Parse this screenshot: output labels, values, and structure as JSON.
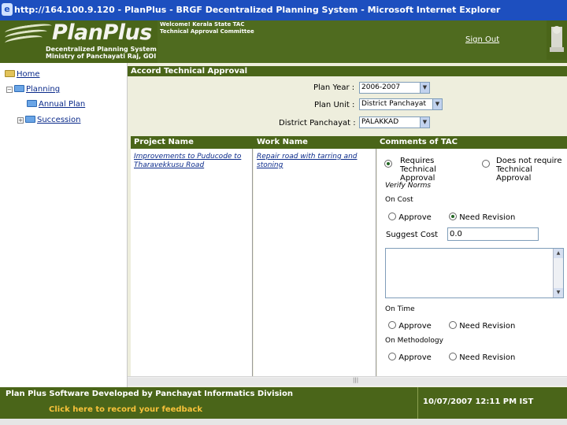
{
  "window": {
    "title": "http://164.100.9.120 - PlanPlus - BRGF Decentralized Planning System - Microsoft Internet Explorer"
  },
  "header": {
    "logo": "PlanPlus",
    "logo_sub1": "Decentralized Planning System",
    "logo_sub2": "Ministry of Panchayati Raj, GOI",
    "welcome": "Welcome! Kerala State TAC Technical Approval Committee",
    "signout": "Sign Out",
    "emblem_icon": "state-emblem-icon"
  },
  "nav": {
    "home": "Home",
    "planning": "Planning",
    "annual_plan": "Annual Plan",
    "succession": "Succession"
  },
  "panel": {
    "title": "Accord Technical Approval",
    "plan_year_label": "Plan Year :",
    "plan_year_value": "2006-2007",
    "plan_unit_label": "Plan Unit :",
    "plan_unit_value": "District Panchayat",
    "district_label": "District Panchayat :",
    "district_value": "PALAKKAD"
  },
  "table": {
    "headers": [
      "Project Name",
      "Work Name",
      "Comments of TAC"
    ],
    "project_name": "Improvements to Puducode to Tharavekkusu Road",
    "work_name": "Repair road with tarring and stoning",
    "requires_approval": "Requires Technical Approval",
    "not_requires_approval": "Does not require Technical Approval",
    "verify_norms": "Verify Norms",
    "on_cost": "On Cost",
    "approve": "Approve",
    "need_revision": "Need Revision",
    "suggest_cost_label": "Suggest Cost",
    "suggest_cost_value": "0.0",
    "on_time": "On Time",
    "on_methodology": "On Methodology"
  },
  "footer": {
    "developed_by": "Plan Plus Software Developed by Panchayat Informatics Division",
    "feedback_link": "Click here to record your feedback",
    "timestamp": "10/07/2007 12:11 PM IST"
  },
  "colors": {
    "header_green": "#4a6519",
    "panel_bg": "#eeeedd",
    "title_blue": "#1d4fbf",
    "feedback_gold": "#f7c23a"
  }
}
